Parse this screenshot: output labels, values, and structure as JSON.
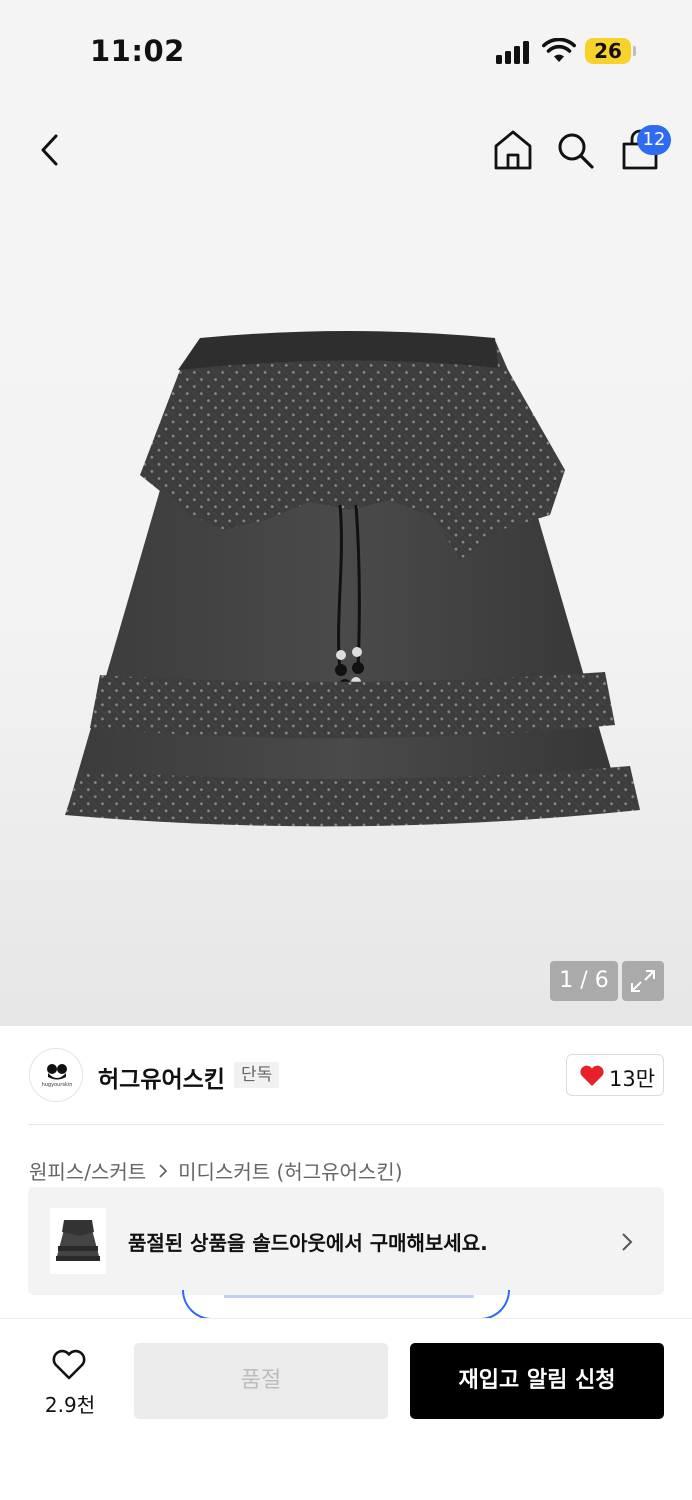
{
  "status_bar": {
    "time": "11:02",
    "battery": "26",
    "icons": [
      "signal-icon",
      "wifi-icon",
      "battery-icon"
    ]
  },
  "top_nav": {
    "icons": [
      "back-arrow-icon",
      "home-icon",
      "search-icon",
      "shopping-bag-icon"
    ],
    "cart_count": "12"
  },
  "gallery": {
    "pager": "1 / 6",
    "icons": [
      "expand-icon"
    ]
  },
  "brand": {
    "logo_text": "hugyourskin",
    "name": "허그유어스킨",
    "tag": "단독",
    "likes": "13만",
    "like_color": "#e8202a"
  },
  "breadcrumb": {
    "category": "원피스/스커트",
    "subcategory": "미디스커트 (허그유어스킨)"
  },
  "soldout_banner": {
    "text": "품절된 상품을 솔드아웃에서 구매해보세요."
  },
  "bottom_bar": {
    "wish_count": "2.9천",
    "soldout_label": "품절",
    "restock_label": "재입고 알림 신청"
  },
  "colors": {
    "accent_blue": "#2f6bf0",
    "primary_button": "#000000",
    "disabled_button": "#ebebeb"
  }
}
